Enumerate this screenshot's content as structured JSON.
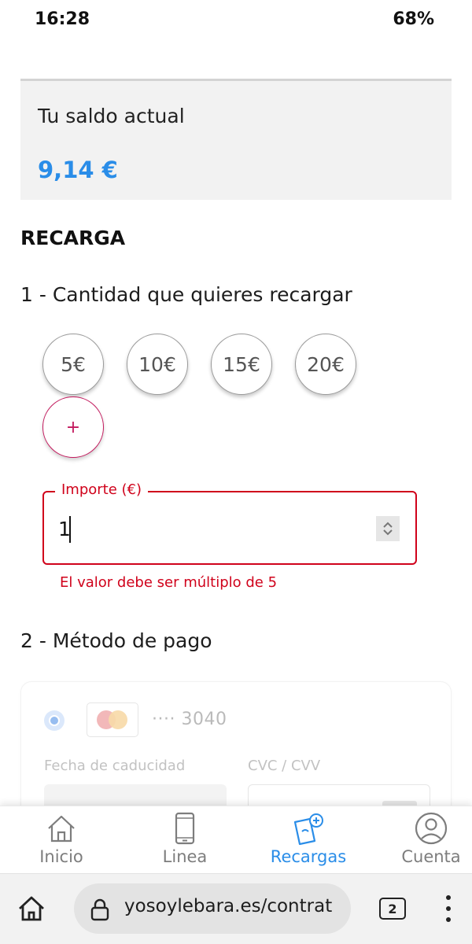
{
  "status_bar": {
    "time": "16:28",
    "battery": "68%"
  },
  "balance": {
    "label": "Tu saldo actual",
    "value": "9,14 €",
    "value_color": "#2a8de8"
  },
  "recharge": {
    "title": "RECARGA",
    "step1_title": "1 - Cantidad que quieres recargar",
    "amounts": [
      "5€",
      "10€",
      "15€",
      "20€"
    ],
    "more_label": "+",
    "amount_field": {
      "label": "Importe (€)",
      "value": "1",
      "error": "El valor debe ser múltiplo de 5",
      "error_color": "#d0021b"
    },
    "step2_title": "2 - Método de pago",
    "payment_card": {
      "brand_icon": "mastercard-icon",
      "number": "···· 3040",
      "expiry_label": "Fecha de caducidad",
      "cvc_label": "CVC / CVV"
    }
  },
  "bottom_nav": {
    "items": [
      {
        "label": "Inicio",
        "icon": "home-icon"
      },
      {
        "label": "Linea",
        "icon": "phone-icon"
      },
      {
        "label": "Recargas",
        "icon": "topup-icon",
        "active": true
      },
      {
        "label": "Cuenta",
        "icon": "account-icon"
      }
    ],
    "active_color": "#2a8de8"
  },
  "browser": {
    "url": "yosoylebara.es/contrat",
    "tab_count": "2"
  }
}
